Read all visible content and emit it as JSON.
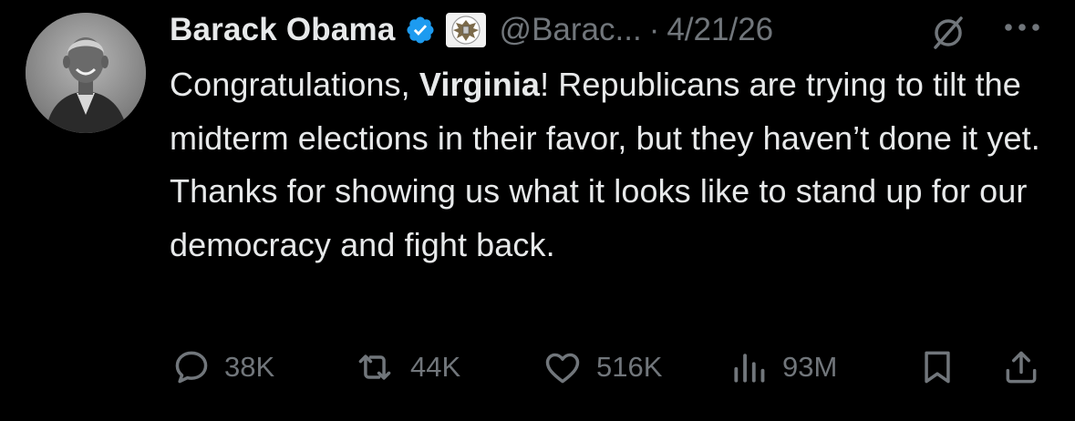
{
  "author": {
    "name": "Barack Obama",
    "handle": "@Barac...",
    "separator": "·",
    "date": "4/21/26",
    "verified": true,
    "affiliation_badge": "us-seal-icon"
  },
  "tweet": {
    "text_before": "Congratulations, ",
    "bold": "Virginia",
    "text_after": "! Republicans are trying to tilt the midterm elections in their favor, but they haven’t done it yet. Thanks for showing us what it looks like to stand up for our democracy and fight back."
  },
  "actions": {
    "replies": "38K",
    "reposts": "44K",
    "likes": "516K",
    "views": "93M"
  },
  "colors": {
    "background": "#000000",
    "text": "#e7e9ea",
    "muted": "#71767b",
    "verified_blue": "#1d9bf0"
  },
  "icons": [
    "reply-icon",
    "repost-icon",
    "like-icon",
    "views-icon",
    "bookmark-icon",
    "share-icon",
    "grok-icon",
    "more-icon",
    "verified-badge-icon",
    "us-seal-icon"
  ]
}
